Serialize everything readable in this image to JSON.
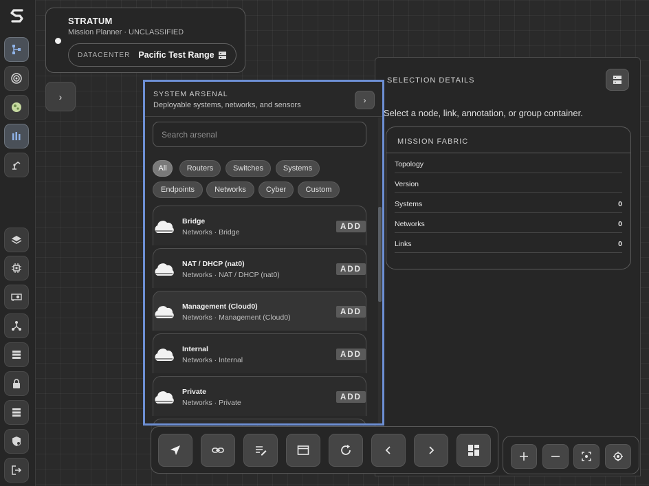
{
  "app": {
    "title": "STRATUM",
    "subtitle": "Mission Planner · UNCLASSIFIED",
    "datacenter_label": "DATACENTER",
    "datacenter_value": "Pacific Test Range"
  },
  "rail": {
    "top_items": [
      "topology-icon",
      "target-icon",
      "globe-icon",
      "bottles-icon",
      "robot-arm-icon"
    ],
    "bottom_items": [
      "layers-icon",
      "chip-icon",
      "gpu-card-icon",
      "hub-icon",
      "server-rack-icon",
      "lock-icon",
      "storage-icon",
      "shield-icon",
      "logout-icon"
    ]
  },
  "arsenal": {
    "title": "SYSTEM ARSENAL",
    "subtitle": "Deployable systems, networks, and sensors",
    "search_placeholder": "Search arsenal",
    "filters": [
      "All",
      "Routers",
      "Switches",
      "Systems",
      "Endpoints",
      "Networks",
      "Cyber",
      "Custom"
    ],
    "active_filter": "All",
    "add_label": "ADD",
    "items": [
      {
        "name": "Bridge",
        "meta": "Networks · Bridge"
      },
      {
        "name": "NAT / DHCP (nat0)",
        "meta": "Networks · NAT / DHCP (nat0)"
      },
      {
        "name": "Management (Cloud0)",
        "meta": "Networks · Management (Cloud0)"
      },
      {
        "name": "Internal",
        "meta": "Networks · Internal"
      },
      {
        "name": "Private",
        "meta": "Networks · Private"
      }
    ]
  },
  "details": {
    "title": "SELECTION DETAILS",
    "hint": "Select a node, link, annotation, or group container.",
    "fabric": {
      "title": "MISSION FABRIC",
      "rows": [
        {
          "label": "Topology",
          "value": ""
        },
        {
          "label": "Version",
          "value": ""
        },
        {
          "label": "Systems",
          "value": "0"
        },
        {
          "label": "Networks",
          "value": "0"
        },
        {
          "label": "Links",
          "value": "0"
        }
      ]
    }
  },
  "toolbar": {
    "tools": [
      "pointer-icon",
      "link-icon",
      "annotate-icon",
      "group-container-icon",
      "refresh-icon",
      "chevron-left-icon",
      "chevron-right-icon",
      "dashboard-icon"
    ]
  },
  "zoom": {
    "tools": [
      "zoom-in-icon",
      "zoom-out-icon",
      "fit-view-icon",
      "locate-icon"
    ]
  },
  "colors": {
    "accent_outline": "#6d8fd4",
    "background": "#2a2a2a"
  }
}
